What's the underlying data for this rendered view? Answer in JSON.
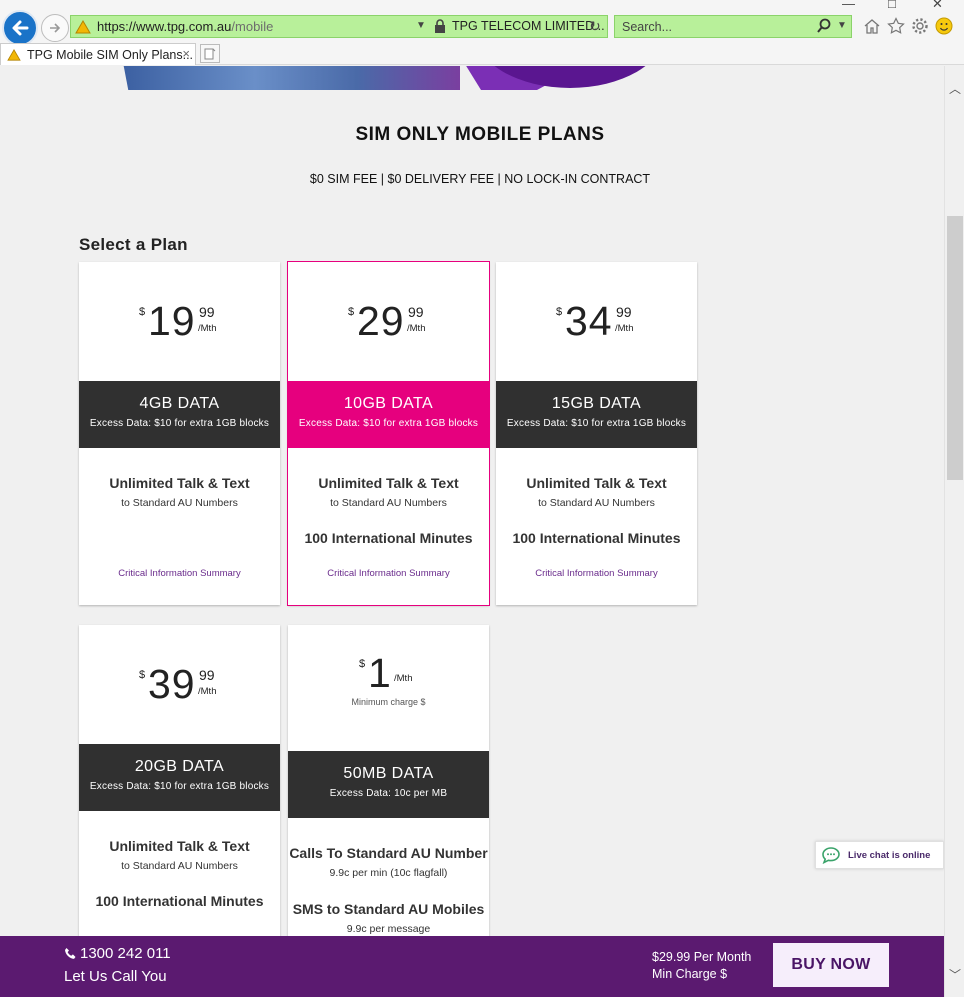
{
  "browser": {
    "url_main": "https://www.tpg.com.au",
    "url_path": "/mobile",
    "cert_label": "TPG TELECOM LIMITED...",
    "search_placeholder": "Search...",
    "tab_title": "TPG Mobile SIM Only Plans...",
    "tab_close": "×"
  },
  "page": {
    "title": "SIM ONLY MOBILE PLANS",
    "fees": "$0 SIM FEE  |  $0 DELIVERY FEE  |  NO LOCK-IN CONTRACT",
    "select_plan": "Select a Plan"
  },
  "plans": [
    {
      "currency": "$",
      "dollars": "19",
      "cents": "99",
      "period": "/Mth",
      "data": "4GB DATA",
      "excess": "Excess Data: $10 for extra 1GB blocks",
      "talk": "Unlimited Talk & Text",
      "talk_sub": "to Standard AU Numbers",
      "intl": "",
      "cis": "Critical Information Summary"
    },
    {
      "currency": "$",
      "dollars": "29",
      "cents": "99",
      "period": "/Mth",
      "data": "10GB DATA",
      "excess": "Excess Data: $10 for extra 1GB blocks",
      "talk": "Unlimited Talk & Text",
      "talk_sub": "to Standard AU Numbers",
      "intl": "100 International Minutes",
      "cis": "Critical Information Summary",
      "selected": true
    },
    {
      "currency": "$",
      "dollars": "34",
      "cents": "99",
      "period": "/Mth",
      "data": "15GB DATA",
      "excess": "Excess Data: $10 for extra 1GB blocks",
      "talk": "Unlimited Talk & Text",
      "talk_sub": "to Standard AU Numbers",
      "intl": "100 International Minutes",
      "cis": "Critical Information Summary"
    },
    {
      "currency": "$",
      "dollars": "39",
      "cents": "99",
      "period": "/Mth",
      "data": "20GB DATA",
      "excess": "Excess Data: $10 for extra 1GB blocks",
      "talk": "Unlimited Talk & Text",
      "talk_sub": "to Standard AU Numbers",
      "intl": "100 International Minutes"
    },
    {
      "currency": "$",
      "dollars": "1",
      "period": "/Mth",
      "min_charge": "Minimum charge $",
      "data": "50MB DATA",
      "excess": "Excess Data: 10c per MB",
      "calls": "Calls To Standard AU Number",
      "calls_sub": "9.9c per min (10c flagfall)",
      "sms": "SMS to Standard AU Mobiles",
      "sms_sub": "9.9c per message"
    }
  ],
  "livechat": {
    "label": "Live chat is online"
  },
  "bottombar": {
    "phone": "1300 242 011",
    "call_you": "Let Us Call You",
    "per_month": "$29.99 Per Month",
    "min_charge": "Min Charge $",
    "buy_now": "BUY NOW"
  },
  "colors": {
    "accent_pink": "#e6007e",
    "band_dark": "#303030",
    "brand_purple": "#5b1a70",
    "address_green": "#b8f09a"
  },
  "icons": [
    "back-arrow-icon",
    "forward-arrow-icon",
    "warning-icon",
    "lock-icon",
    "refresh-icon",
    "search-icon",
    "home-icon",
    "star-icon",
    "gear-icon",
    "smiley-icon",
    "phone-icon",
    "chat-bubble-icon",
    "chevron-up-icon",
    "chevron-down-icon"
  ]
}
